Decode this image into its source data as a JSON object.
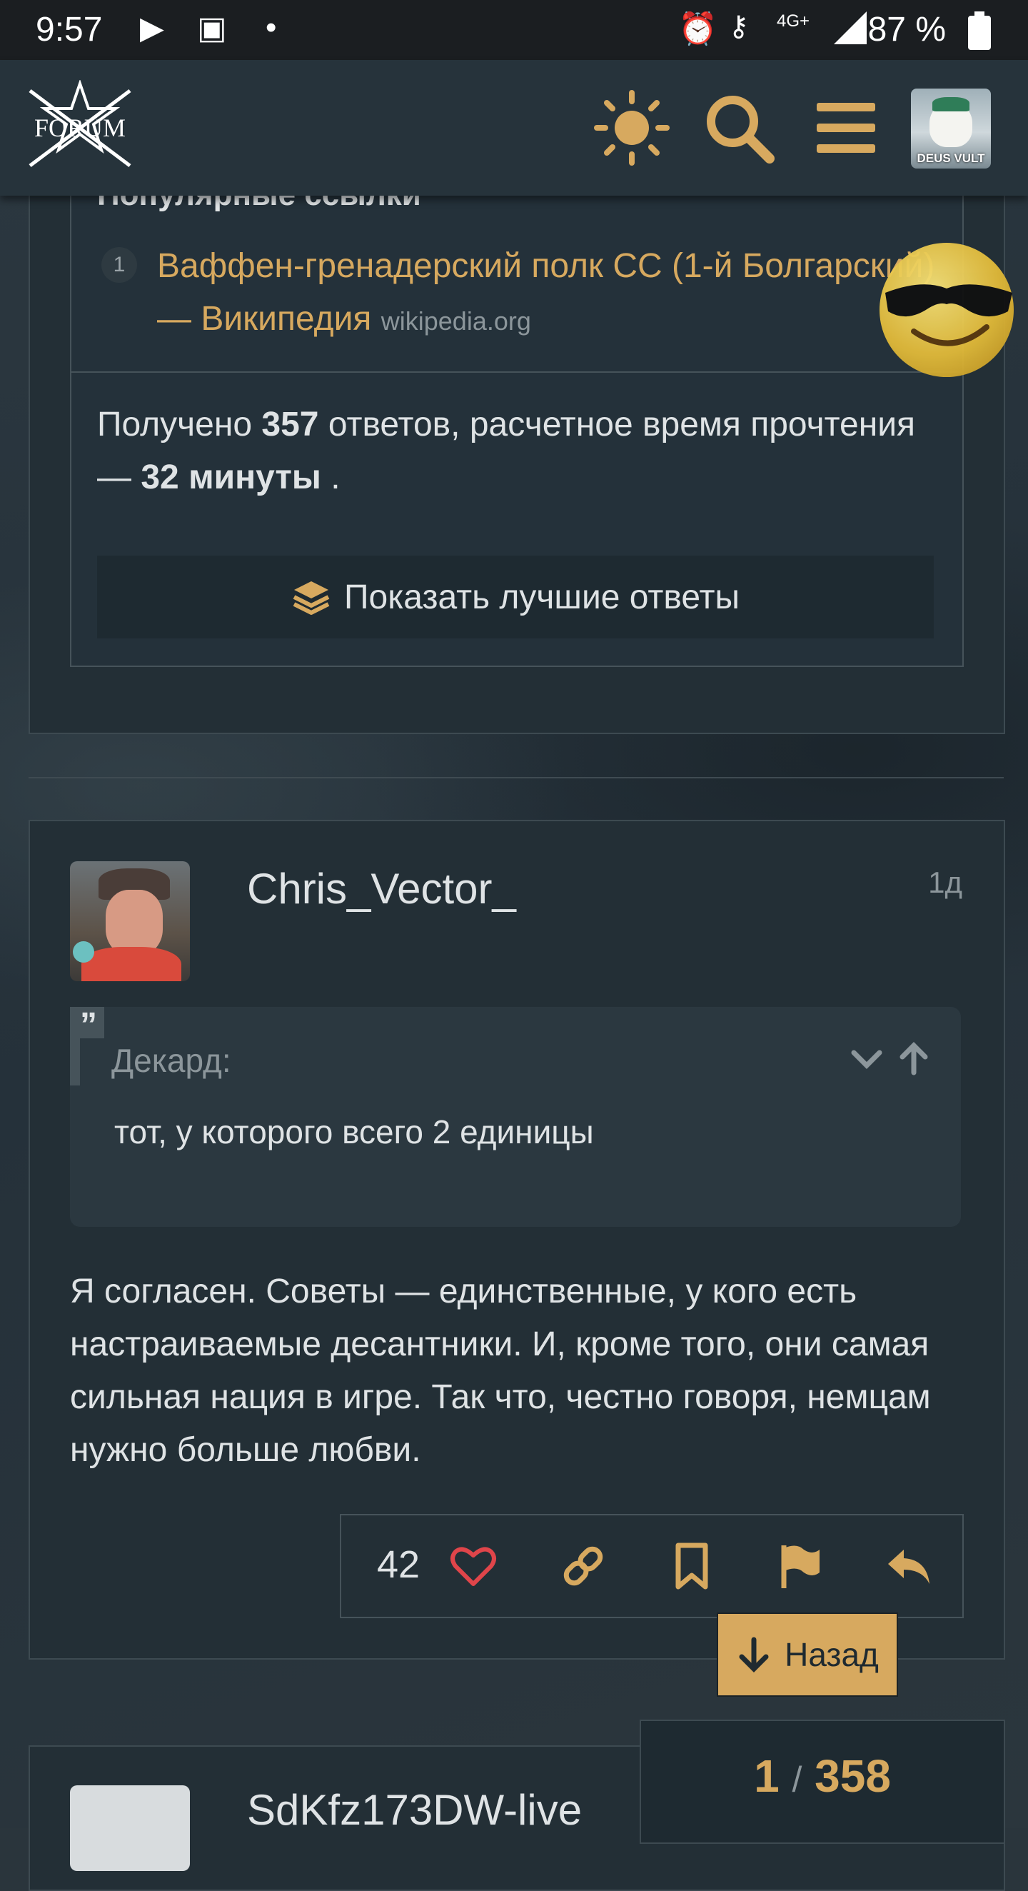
{
  "status_bar": {
    "time": "9:57",
    "network": "4G+",
    "battery": "87 %"
  },
  "header": {
    "logo_text": "FORUM",
    "avatar_caption": "DEUS VULT"
  },
  "popular_links": {
    "title": "Популярные ссылки",
    "items": [
      {
        "num": "1",
        "text": "Ваффен-гренадерский полк СС (1-й Болгарский) — Википедия",
        "domain": "wikipedia.org"
      }
    ]
  },
  "summary": {
    "prefix": "Получено",
    "replies_count": "357",
    "middle": "ответов, расчетное время прочтения —",
    "read_time": "32 минуты",
    "suffix": "."
  },
  "show_best_label": "Показать лучшие ответы",
  "post": {
    "username": "Chris_Vector_",
    "time": "1д",
    "quote_author": "Декард:",
    "quote_text": "тот, у которого всего 2 единицы",
    "body": "Я согласен. Советы — единственные, у кого есть настраиваемые десантники. И, кроме того, они самая сильная нация в игре. Так что, честно говоря, немцам нужно больше любви.",
    "likes": "42"
  },
  "back_label": "Назад",
  "progress": {
    "current": "1",
    "separator": "/",
    "total": "358"
  },
  "next_post": {
    "username": "SdKfz173DW-live"
  },
  "colors": {
    "accent": "#d7a95f",
    "like": "#e0454a",
    "background": "#2a353c",
    "card": "#232f36"
  },
  "icons": [
    "theme-sun-icon",
    "search-icon",
    "hamburger-menu-icon",
    "layers-icon",
    "chevron-down-icon",
    "arrow-up-icon",
    "heart-icon",
    "link-icon",
    "bookmark-icon",
    "flag-icon",
    "reply-icon",
    "arrow-down-icon",
    "sunglasses-smiley-icon"
  ]
}
